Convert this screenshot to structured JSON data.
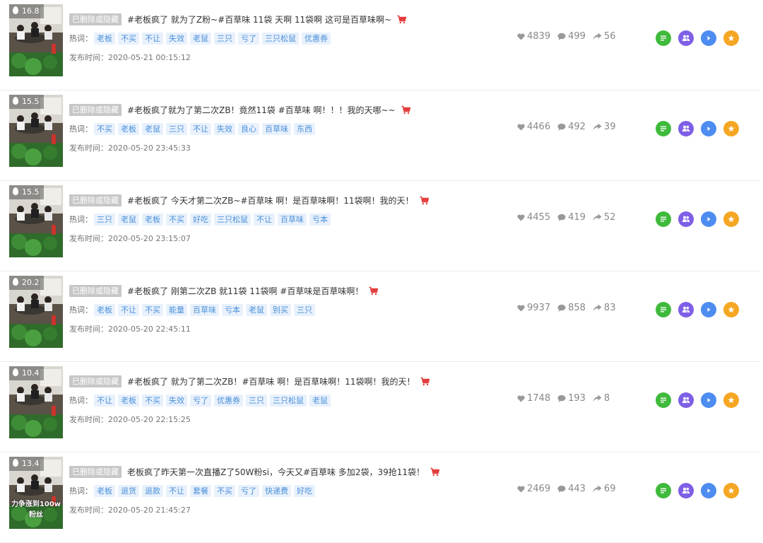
{
  "colors": {
    "green": "#3fba3c",
    "purple": "#7e5fe6",
    "blue": "#4d8cf0",
    "orange": "#f5a623",
    "tag_text": "#4a90d9",
    "tag_bg": "#e8f1fc",
    "cart": "#e43c3c"
  },
  "labels": {
    "deleted_badge": "已删除或隐藏",
    "hot_words": "热词：",
    "published_prefix": "发布时间："
  },
  "icons": {
    "heat": "fire-icon",
    "cart": "shopping-cart-icon",
    "likes": "heart-icon",
    "comments": "comment-icon",
    "shares": "share-icon",
    "actions": [
      "list-icon",
      "users-icon",
      "play-icon",
      "star-icon"
    ]
  },
  "rows": [
    {
      "heat": "16.8",
      "title": "#老板疯了 就为了Z粉~#百草味 11袋 天啊 11袋啊 这可是百草味啊~",
      "tags": [
        "老板",
        "不买",
        "不让",
        "失效",
        "老鼠",
        "三只",
        "亏了",
        "三只松鼠",
        "优惠券"
      ],
      "date": "2020-05-21 00:15:12",
      "likes": "4839",
      "comments": "499",
      "shares": "56",
      "caption": ""
    },
    {
      "heat": "15.5",
      "title": "#老板疯了就为了第二次ZB！竟然11袋 #百草味 啊！！！我的天哪~~",
      "tags": [
        "不买",
        "老板",
        "老鼠",
        "三只",
        "不让",
        "失效",
        "良心",
        "百草味",
        "东西"
      ],
      "date": "2020-05-20 23:45:33",
      "likes": "4466",
      "comments": "492",
      "shares": "39",
      "caption": ""
    },
    {
      "heat": "15.5",
      "title": "#老板疯了 今天才第二次ZB~#百草味 啊！是百草味啊！11袋啊！我的天！",
      "tags": [
        "三只",
        "老鼠",
        "老板",
        "不买",
        "好吃",
        "三只松鼠",
        "不让",
        "百草味",
        "亏本"
      ],
      "date": "2020-05-20 23:15:07",
      "likes": "4455",
      "comments": "419",
      "shares": "52",
      "caption": ""
    },
    {
      "heat": "20.2",
      "title": "#老板疯了 刚第二次ZB 就11袋 11袋啊 #百草味是百草味啊！",
      "tags": [
        "老板",
        "不让",
        "不买",
        "能量",
        "百草味",
        "亏本",
        "老鼠",
        "别买",
        "三只"
      ],
      "date": "2020-05-20 22:45:11",
      "likes": "9937",
      "comments": "858",
      "shares": "83",
      "caption": ""
    },
    {
      "heat": "10.4",
      "title": "#老板疯了 就为了第二次ZB！#百草味 啊！是百草味啊！11袋啊！我的天！",
      "tags": [
        "不让",
        "老板",
        "不买",
        "失效",
        "亏了",
        "优惠券",
        "三只",
        "三只松鼠",
        "老鼠"
      ],
      "date": "2020-05-20 22:15:25",
      "likes": "1748",
      "comments": "193",
      "shares": "8",
      "caption": ""
    },
    {
      "heat": "13.4",
      "title": "老板疯了昨天第一次直播Z了50W粉si，今天又#百草味 多加2袋，39抢11袋！",
      "tags": [
        "老板",
        "退货",
        "退款",
        "不让",
        "套餐",
        "不买",
        "亏了",
        "快递费",
        "好吃"
      ],
      "date": "2020-05-20 21:45:27",
      "likes": "2469",
      "comments": "443",
      "shares": "69",
      "caption": "力争涨到100w粉丝"
    }
  ]
}
